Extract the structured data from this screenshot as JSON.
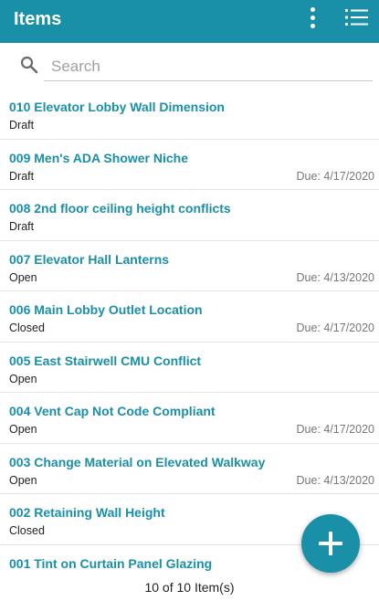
{
  "header": {
    "title": "Items",
    "more_icon": "more-vert-icon",
    "list_icon": "list-view-icon"
  },
  "search": {
    "placeholder": "Search",
    "value": "",
    "icon": "search-icon"
  },
  "items": [
    {
      "title": "010 Elevator Lobby Wall Dimension",
      "status": "Draft",
      "due": ""
    },
    {
      "title": "009 Men's ADA Shower Niche",
      "status": "Draft",
      "due": "Due: 4/17/2020"
    },
    {
      "title": "008 2nd floor ceiling height conflicts",
      "status": "Draft",
      "due": ""
    },
    {
      "title": "007 Elevator Hall Lanterns",
      "status": "Open",
      "due": "Due: 4/13/2020"
    },
    {
      "title": "006 Main Lobby Outlet Location",
      "status": "Closed",
      "due": "Due: 4/17/2020"
    },
    {
      "title": "005 East Stairwell CMU Conflict",
      "status": "Open",
      "due": ""
    },
    {
      "title": "004 Vent Cap Not Code Compliant",
      "status": "Open",
      "due": "Due: 4/17/2020"
    },
    {
      "title": "003 Change Material on Elevated Walkway",
      "status": "Open",
      "due": "Due: 4/13/2020"
    },
    {
      "title": "002 Retaining Wall Height",
      "status": "Closed",
      "due": ""
    },
    {
      "title": "001 Tint on Curtain Panel Glazing",
      "status": "",
      "due": ""
    }
  ],
  "footer": {
    "count_text": "10 of 10 Item(s)"
  },
  "fab": {
    "icon": "plus-icon"
  },
  "colors": {
    "accent": "#1a8fa8",
    "divider": "#e4e4e4"
  }
}
